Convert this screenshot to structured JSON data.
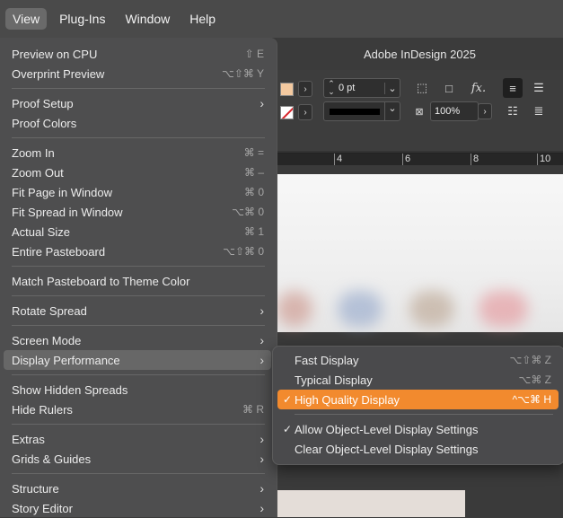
{
  "menubar": {
    "items": [
      "View",
      "Plug-Ins",
      "Window",
      "Help"
    ]
  },
  "app": {
    "title": "Adobe InDesign 2025",
    "controls": {
      "stroke_weight": "0 pt",
      "scale": "100%",
      "fx_label": "fx."
    },
    "ruler_labels": [
      "4",
      "6",
      "8",
      "10"
    ]
  },
  "view_menu": {
    "items": [
      {
        "label": "Preview on CPU",
        "shortcut": "⇧ E"
      },
      {
        "label": "Overprint Preview",
        "shortcut": "⌥⇧⌘ Y"
      },
      {
        "label": "Proof Setup",
        "submenu": true
      },
      {
        "label": "Proof Colors",
        "shortcut": ""
      },
      {
        "label": "Zoom In",
        "shortcut": "⌘ ="
      },
      {
        "label": "Zoom Out",
        "shortcut": "⌘ –"
      },
      {
        "label": "Fit Page in Window",
        "shortcut": "⌘ 0"
      },
      {
        "label": "Fit Spread in Window",
        "shortcut": "⌥⌘ 0"
      },
      {
        "label": "Actual Size",
        "shortcut": "⌘ 1"
      },
      {
        "label": "Entire Pasteboard",
        "shortcut": "⌥⇧⌘ 0"
      },
      {
        "label": "Match Pasteboard to Theme Color",
        "shortcut": ""
      },
      {
        "label": "Rotate Spread",
        "submenu": true
      },
      {
        "label": "Screen Mode",
        "submenu": true
      },
      {
        "label": "Display Performance",
        "submenu": true
      },
      {
        "label": "Show Hidden Spreads",
        "shortcut": ""
      },
      {
        "label": "Hide Rulers",
        "shortcut": "⌘ R"
      },
      {
        "label": "Extras",
        "submenu": true
      },
      {
        "label": "Grids & Guides",
        "submenu": true
      },
      {
        "label": "Structure",
        "submenu": true
      },
      {
        "label": "Story Editor",
        "submenu": true
      }
    ],
    "submenu_arrow": "›"
  },
  "display_performance_submenu": {
    "items": [
      {
        "label": "Fast Display",
        "shortcut": "⌥⇧⌘ Z",
        "checked": false
      },
      {
        "label": "Typical Display",
        "shortcut": "⌥⌘ Z",
        "checked": false
      },
      {
        "label": "High Quality Display",
        "shortcut": "^⌥⌘ H",
        "checked": true
      },
      {
        "label": "Allow Object-Level Display Settings",
        "shortcut": "",
        "checked": true
      },
      {
        "label": "Clear Object-Level Display Settings",
        "shortcut": "",
        "checked": false
      }
    ],
    "check_glyph": "✓"
  },
  "colors": {
    "highlight": "#f28a2e",
    "fill_swatch": "#f3c9a0",
    "stroke_swatch": "#d8232a"
  }
}
